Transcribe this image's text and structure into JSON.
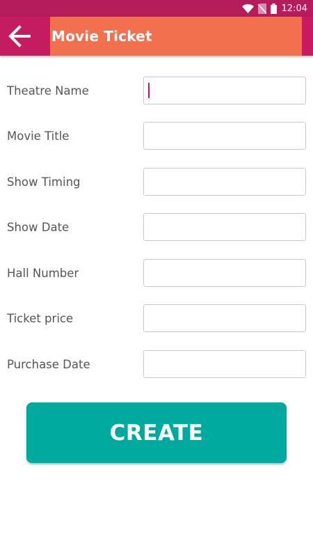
{
  "status_bar": {
    "time": "12:04",
    "icons": [
      "wifi-icon",
      "no-sim-icon",
      "battery-icon"
    ]
  },
  "app_bar": {
    "back_icon": "arrow-left-icon",
    "title": "Movie Ticket"
  },
  "form": {
    "fields": [
      {
        "label": "Theatre Name",
        "value": "",
        "focused": true
      },
      {
        "label": "Movie Title",
        "value": ""
      },
      {
        "label": "Show Timing",
        "value": ""
      },
      {
        "label": "Show Date",
        "value": ""
      },
      {
        "label": "Hall Number",
        "value": ""
      },
      {
        "label": "Ticket price",
        "value": ""
      },
      {
        "label": "Purchase Date",
        "value": ""
      }
    ],
    "submit_label": "CREATE"
  },
  "colors": {
    "status_bar": "#b51c5c",
    "app_bar": "#c41c5e",
    "title_block": "#f3704f",
    "button": "#00a99d",
    "cursor": "#d3155f"
  }
}
